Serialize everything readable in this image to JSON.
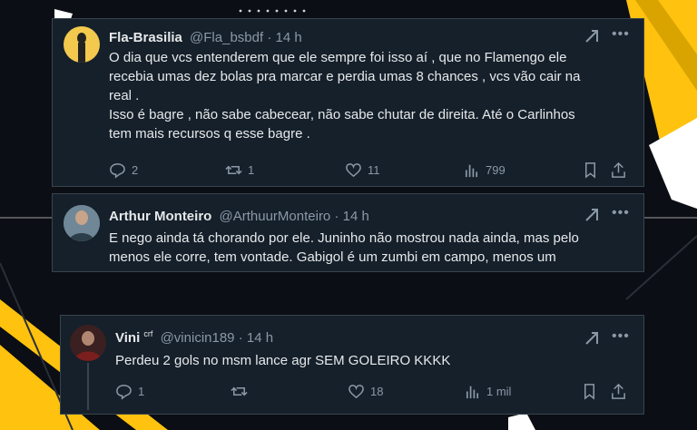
{
  "tweets": [
    {
      "name": "Fla-Brasilia",
      "handle": "@Fla_bsbdf",
      "time": "14 h",
      "lines": [
        "O dia que vcs entenderem que ele sempre foi isso aí , que no Flamengo ele",
        "recebia umas dez bolas pra marcar e perdia umas 8 chances , vcs vão cair na",
        "real .",
        "Isso é bagre , não sabe cabecear, não sabe chutar de direita. Até o Carlinhos",
        "tem mais recursos q esse bagre ."
      ],
      "replies": "2",
      "retweets": "1",
      "likes": "11",
      "views": "799"
    },
    {
      "name": "Arthur Monteiro",
      "handle": "@ArthuurMonteiro",
      "time": "14 h",
      "lines": [
        "E nego ainda tá chorando por ele. Juninho não mostrou nada ainda, mas pelo",
        "menos ele corre, tem vontade. Gabigol é um zumbi em campo, menos um"
      ]
    },
    {
      "name": "Vini",
      "badge": "crf",
      "handle": "@vinicin189",
      "time": "14 h",
      "lines": [
        "Perdeu 2 gols no msm lance agr SEM GOLEIRO KKKK"
      ],
      "replies": "1",
      "retweets": "",
      "likes": "18",
      "views": "1 mil"
    }
  ],
  "separator": "·",
  "colors": {
    "accent": "#ffc20e",
    "card": "#15202b",
    "text": "#e7e9ea",
    "muted": "#8b98a5"
  }
}
